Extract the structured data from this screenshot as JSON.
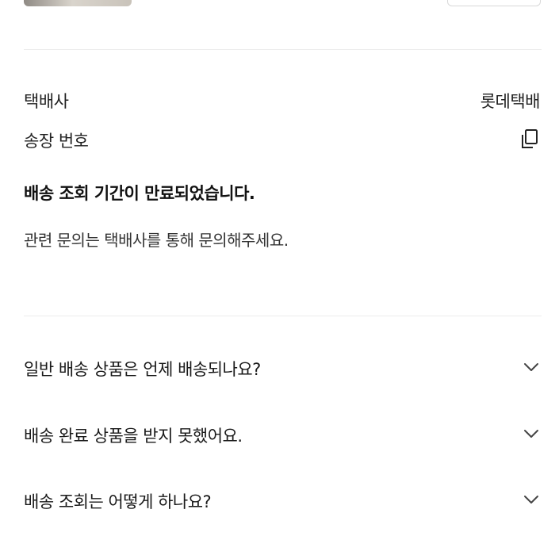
{
  "shipping_info": {
    "carrier_label": "택배사",
    "carrier_value": "롯데택배",
    "tracking_label": "송장 번호"
  },
  "notice": {
    "title": "배송 조회 기간이 만료되었습니다.",
    "description": "관련 문의는 택배사를 통해 문의해주세요."
  },
  "faq": {
    "items": [
      {
        "question": "일반 배송 상품은 언제 배송되나요?"
      },
      {
        "question": "배송 완료 상품을 받지 못했어요."
      },
      {
        "question": "배송 조회는 어떻게 하나요?"
      }
    ]
  },
  "icons": {
    "copy": "copy-icon",
    "expand": "chevron-down-icon"
  },
  "colors": {
    "divider": "#ececec",
    "text": "#1a1a1a"
  }
}
